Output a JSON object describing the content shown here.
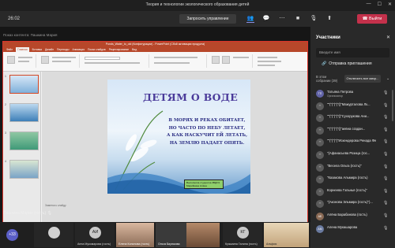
{
  "window": {
    "title": "Теория и технологии экологического образования детей"
  },
  "call": {
    "time": "26:02",
    "request_control": "Запросить управление",
    "leave": "Выйти",
    "leave_color": "#c4314b",
    "icons": [
      "people-icon",
      "chat-icon",
      "more-icon",
      "camera-icon",
      "mic-icon",
      "share-icon"
    ]
  },
  "stage": {
    "caption": "Показ контента: Пашкина Мария",
    "presenter": "Пашкина Мария (гость)"
  },
  "ppt": {
    "title_bar": "Ponds_Water_to_old (Конфигурации) - PowerPoint (Сбой активации продукта)",
    "tabs": [
      "Файл",
      "Главная",
      "Вставка",
      "Дизайн",
      "Переходы",
      "Анимация",
      "Показ слайдов",
      "Рецензирование",
      "Вид"
    ],
    "slide": {
      "title": "ДЕТЯМ О ВОДЕ",
      "poem": [
        "В МОРЯХ И РЕКАХ ОБИТАЕТ,",
        "НО ЧАСТО ПО НЕБУ ЛЕТАЕТ,",
        "А КАК НАСКУЧИТ ЕЙ ЛЕТАТЬ,",
        "НА ЗЕМЛЮ ПАДАЕТ ОПЯТЬ."
      ],
      "caption": [
        "Выполнила студентка 3ВДО1",
        "Марийкина Алёна"
      ]
    },
    "thumb_numbers": [
      "1",
      "2",
      "3",
      "4"
    ],
    "notes": "Заметки к слайду"
  },
  "strip": {
    "count": "+33",
    "tiles": [
      {
        "initials": "АИ",
        "name": "Анна Мукомарова (гость)",
        "color": "#c8c8c8"
      },
      {
        "initials": "",
        "name": "Елена Кононова (гость)",
        "color": ""
      },
      {
        "initials": "",
        "name": "Ольга Бирюкова",
        "color": ""
      },
      {
        "initials": "КГ",
        "name": "Кузьмина Галина (гость)",
        "color": "#c8c8c8"
      },
      {
        "initials": "",
        "name": "Альфия",
        "color": ""
      }
    ]
  },
  "panel": {
    "title": "Участники",
    "search_placeholder": "Введите имя",
    "share_invite": "Отправка приглашения",
    "section_title": "В этом собрании (39)",
    "mute_all": "Отключить все микр...",
    "participants": [
      {
        "initials": "ТП",
        "name": "Татьяна Петрова",
        "role": "Организатор"
      },
      {
        "initials": "\"\"",
        "name": "\"\"(\"(\"(\"(\"((\"Мажурталова Лк...",
        "role": ""
      },
      {
        "initials": "\"\"",
        "name": "\"\"(\"(\"(\"(\"((\"Сухорукова Ани...",
        "role": ""
      },
      {
        "initials": "\"\"",
        "name": "\"\"(\"(\"(\"(\"((\"аевна создан...",
        "role": ""
      },
      {
        "initials": "\"\"",
        "name": "\"\"(\"(\"(\"(\"Искендерова Ренада Фе...",
        "role": ""
      },
      {
        "initials": "\"\"",
        "name": "\"(Афанасьева Розица (гос...",
        "role": ""
      },
      {
        "initials": "\"\"",
        "name": "\"Весела Ольга (гость)\"",
        "role": ""
      },
      {
        "initials": "\"\"",
        "name": "\"Казакова Альмира (гость)",
        "role": ""
      },
      {
        "initials": "\"\"",
        "name": "Корнеева Гэльнья (гость)\"",
        "role": ""
      },
      {
        "initials": "\"\"",
        "name": "\"(Аконова Эльмира (гость)\")...",
        "role": ""
      },
      {
        "initials": "АБ",
        "name": "Алёна Барабанова (гость)",
        "role": ""
      },
      {
        "initials": "АМ",
        "name": "Алена Мукашарова",
        "role": ""
      }
    ]
  }
}
